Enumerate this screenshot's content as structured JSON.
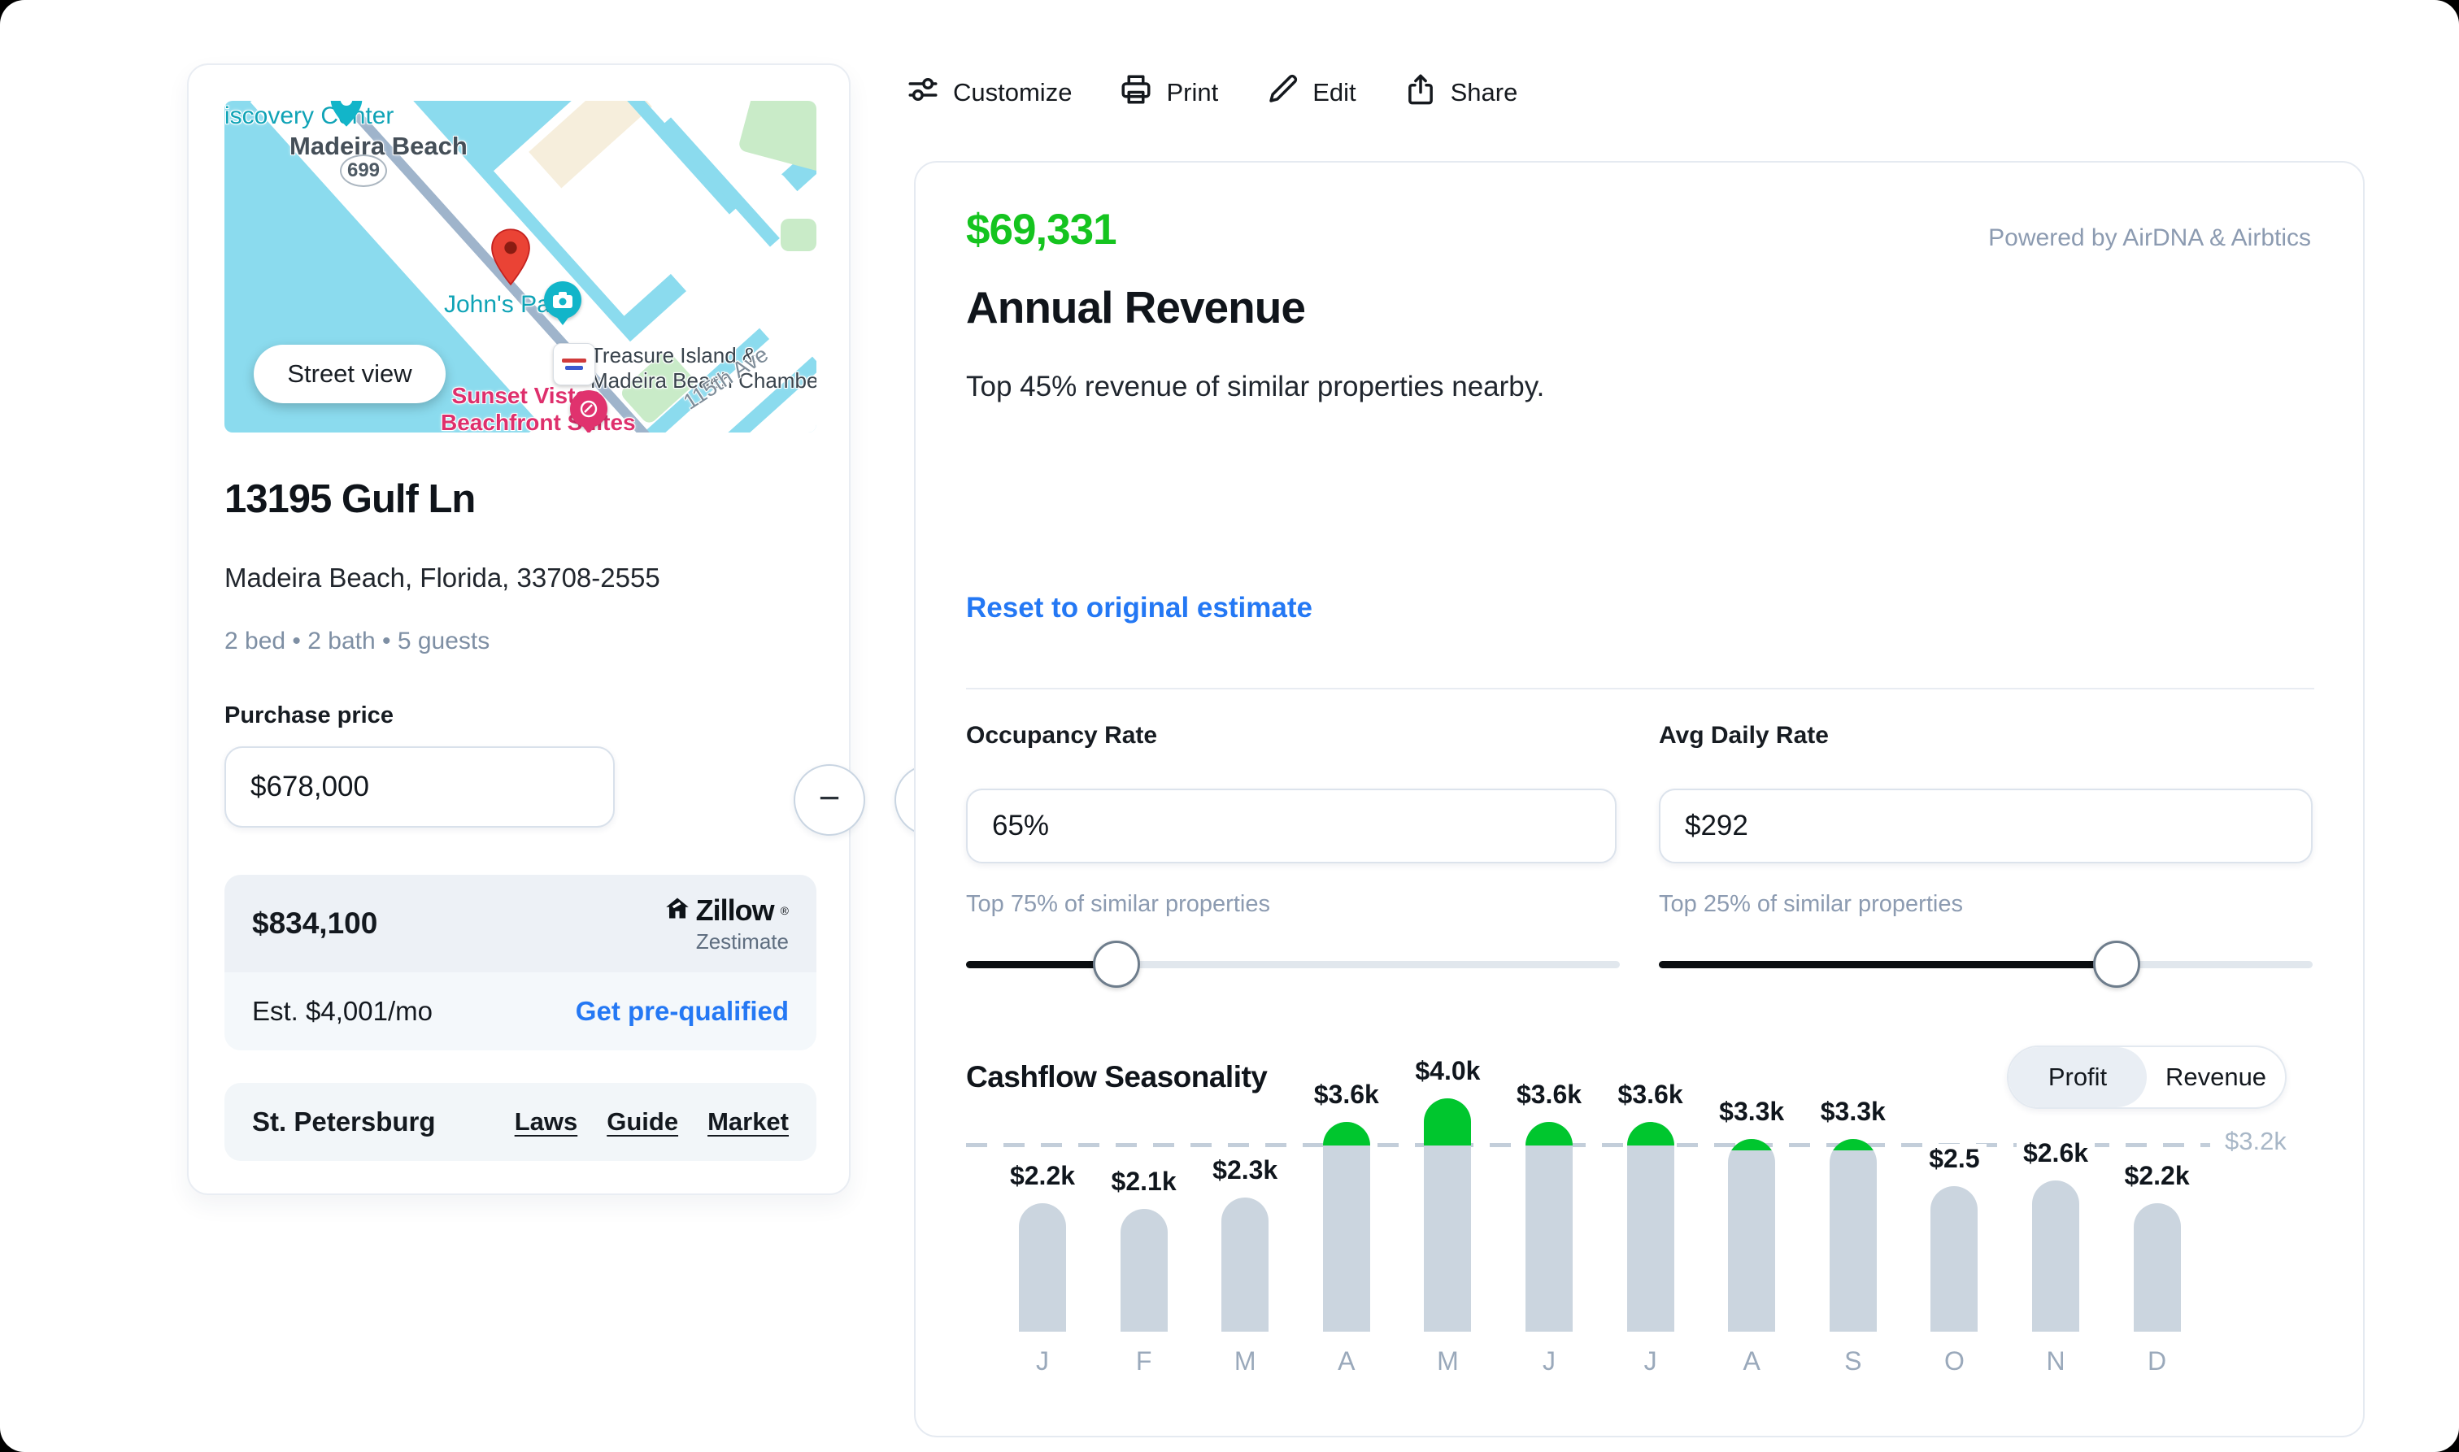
{
  "property_card": {
    "map": {
      "street_view_label": "Street view",
      "labels": [
        {
          "id": "discovery-center",
          "text": "iscovery Center",
          "color": "#0FA3B6"
        },
        {
          "id": "madeira-beach",
          "text": "Madeira Beach",
          "color": "#454F58"
        },
        {
          "id": "route-699",
          "text": "699",
          "color": "#4E5A64"
        },
        {
          "id": "johns-pass",
          "text": "John's Pass",
          "color": "#0FA3B6"
        },
        {
          "id": "treasure-island",
          "lines": [
            "Treasure Island &",
            "Madeira Beach Chamber o..."
          ],
          "color": "#39434C"
        },
        {
          "id": "sunset-vistas",
          "lines": [
            "Sunset Vistas",
            "Beachfront Suites"
          ],
          "color": "#DE2F6C"
        },
        {
          "id": "115th-ave",
          "text": "115th Ave",
          "color": "#7E8C98"
        }
      ]
    },
    "address_title": "13195 Gulf Ln",
    "address_sub": "Madeira Beach, Florida, 33708-2555",
    "facts": "2 bed • 2 bath • 5 guests",
    "purchase_price_label": "Purchase price",
    "purchase_price_value": "$678,000",
    "stepper": {
      "minus": "−",
      "plus": "+"
    },
    "zestimate": {
      "price": "$834,100",
      "brand": "Zillow",
      "reg": "®",
      "brand_sub": "Zestimate"
    },
    "mortgage": {
      "est": "Est. $4,001/mo",
      "cta": "Get pre-qualified"
    },
    "market_row": {
      "city": "St. Petersburg",
      "links": [
        "Laws",
        "Guide",
        "Market"
      ]
    }
  },
  "toolbar": {
    "items": [
      {
        "id": "customize",
        "label": "Customize",
        "icon": "sliders-icon"
      },
      {
        "id": "print",
        "label": "Print",
        "icon": "printer-icon"
      },
      {
        "id": "edit",
        "label": "Edit",
        "icon": "pencil-icon"
      },
      {
        "id": "share",
        "label": "Share",
        "icon": "share-icon"
      }
    ]
  },
  "revenue_panel": {
    "amount": "$69,331",
    "powered_by": "Powered by AirDNA & Airbtics",
    "title": "Annual Revenue",
    "subtitle": "Top 45% revenue of similar properties nearby.",
    "reset_link": "Reset to original estimate",
    "occupancy": {
      "label": "Occupancy Rate",
      "value": "65%",
      "caption": "Top 75% of similar properties",
      "slider_percent": 23
    },
    "adr": {
      "label": "Avg Daily Rate",
      "value": "$292",
      "caption": "Top 25% of similar properties",
      "slider_percent": 70
    },
    "seasonality": {
      "title": "Cashflow Seasonality",
      "toggle": [
        "Profit",
        "Revenue"
      ],
      "selected": "Profit"
    }
  },
  "chart_data": {
    "type": "bar",
    "title": "Cashflow Seasonality",
    "categories": [
      "J",
      "F",
      "M",
      "A",
      "M",
      "J",
      "J",
      "A",
      "S",
      "O",
      "N",
      "D"
    ],
    "values": [
      2200,
      2100,
      2300,
      3600,
      4000,
      3600,
      3600,
      3300,
      3300,
      2500,
      2600,
      2200
    ],
    "labels": [
      "$2.2k",
      "$2.1k",
      "$2.3k",
      "$3.6k",
      "$4.0k",
      "$3.6k",
      "$3.6k",
      "$3.3k",
      "$3.3k",
      "$2.5",
      "$2.6k",
      "$2.2k"
    ],
    "threshold_value": 3200,
    "threshold_label": "$3.2k",
    "ylim": [
      0,
      4000
    ],
    "grid": false,
    "legend": false,
    "bar_color": "#CBD5DF",
    "above_color": "#00C62E"
  },
  "colors": {
    "accent_green": "#15C41F",
    "cap_green": "#00C62E",
    "link_blue": "#2478F4",
    "bar_gray": "#CBD5DF",
    "map_water": "#8BDBEE",
    "pin_red": "#EA4335"
  }
}
